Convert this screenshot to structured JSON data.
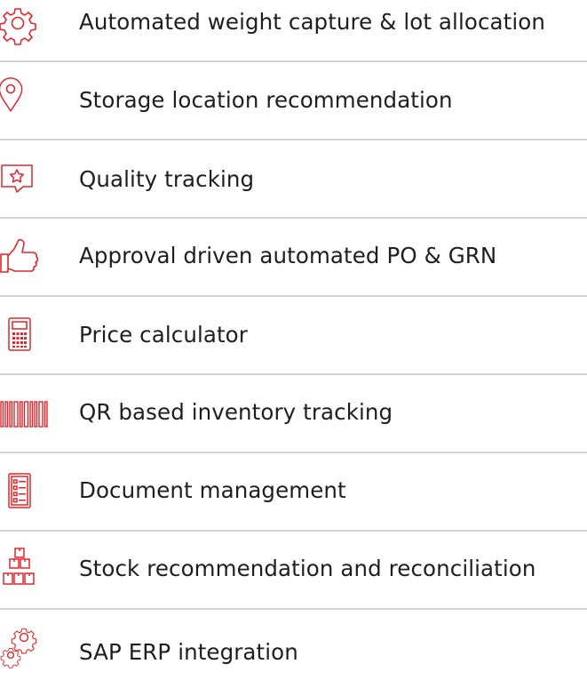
{
  "accent_color": "#e0262b",
  "features": [
    {
      "label": "Automated weight capture & lot allocation",
      "icon": "gear-icon"
    },
    {
      "label": "Storage location recommendation",
      "icon": "map-pin-icon"
    },
    {
      "label": "Quality tracking",
      "icon": "star-badge-icon"
    },
    {
      "label": "Approval driven automated PO & GRN",
      "icon": "thumbs-up-icon"
    },
    {
      "label": "Price calculator",
      "icon": "calculator-icon"
    },
    {
      "label": "QR based inventory tracking",
      "icon": "barcode-icon"
    },
    {
      "label": "Document management",
      "icon": "document-list-icon"
    },
    {
      "label": "Stock recommendation and reconciliation",
      "icon": "stacked-boxes-icon"
    },
    {
      "label": "SAP ERP integration",
      "icon": "gears-icon"
    }
  ]
}
